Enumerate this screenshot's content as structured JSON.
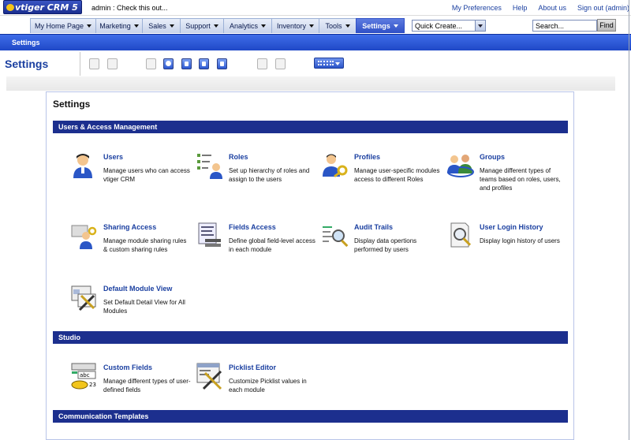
{
  "app": {
    "logo_text": "vtiger CRM 5",
    "admin_message": "admin : Check this out..."
  },
  "top_links": [
    "My Preferences",
    "Help",
    "About us",
    "Sign out (admin)"
  ],
  "nav_tabs": [
    {
      "label": "My Home Page",
      "active": false
    },
    {
      "label": "Marketing",
      "active": false
    },
    {
      "label": "Sales",
      "active": false
    },
    {
      "label": "Support",
      "active": false
    },
    {
      "label": "Analytics",
      "active": false
    },
    {
      "label": "Inventory",
      "active": false
    },
    {
      "label": "Tools",
      "active": false
    },
    {
      "label": "Settings",
      "active": true
    }
  ],
  "quick_create": {
    "value": "Quick Create..."
  },
  "search": {
    "value": "Search...",
    "button": "Find"
  },
  "breadcrumb": "Settings",
  "page_title": "Settings",
  "panel_title": "Settings",
  "sections": [
    {
      "title": "Users & Access Management",
      "items": [
        {
          "name": "Users",
          "desc": "Manage users who can access vtiger CRM",
          "icon": "user-icon"
        },
        {
          "name": "Roles",
          "desc": "Set up hierarchy of roles and assign to the users",
          "icon": "roles-icon"
        },
        {
          "name": "Profiles",
          "desc": "Manage user-specific modules access to different Roles",
          "icon": "profiles-key-icon"
        },
        {
          "name": "Groups",
          "desc": "Manage different types of teams based on roles, users, and profiles",
          "icon": "groups-icon"
        },
        {
          "name": "Sharing Access",
          "desc": "Manage module sharing rules & custom sharing rules",
          "icon": "sharing-access-icon"
        },
        {
          "name": "Fields Access",
          "desc": "Define global field-level access in each module",
          "icon": "fields-access-icon"
        },
        {
          "name": "Audit Trails",
          "desc": "Display data opertions performed by users",
          "icon": "audit-trails-icon"
        },
        {
          "name": "User Login History",
          "desc": "Display login history of users",
          "icon": "login-history-icon"
        },
        {
          "name": "Default Module View",
          "desc": "Set Default Detail View for All Modules",
          "icon": "default-module-view-icon"
        }
      ]
    },
    {
      "title": "Studio",
      "items": [
        {
          "name": "Custom Fields",
          "desc": "Manage different types of user-defined fields",
          "icon": "custom-fields-icon"
        },
        {
          "name": "Picklist Editor",
          "desc": "Customize Picklist values in each module",
          "icon": "picklist-editor-icon"
        }
      ]
    },
    {
      "title": "Communication Templates",
      "items": []
    }
  ]
}
